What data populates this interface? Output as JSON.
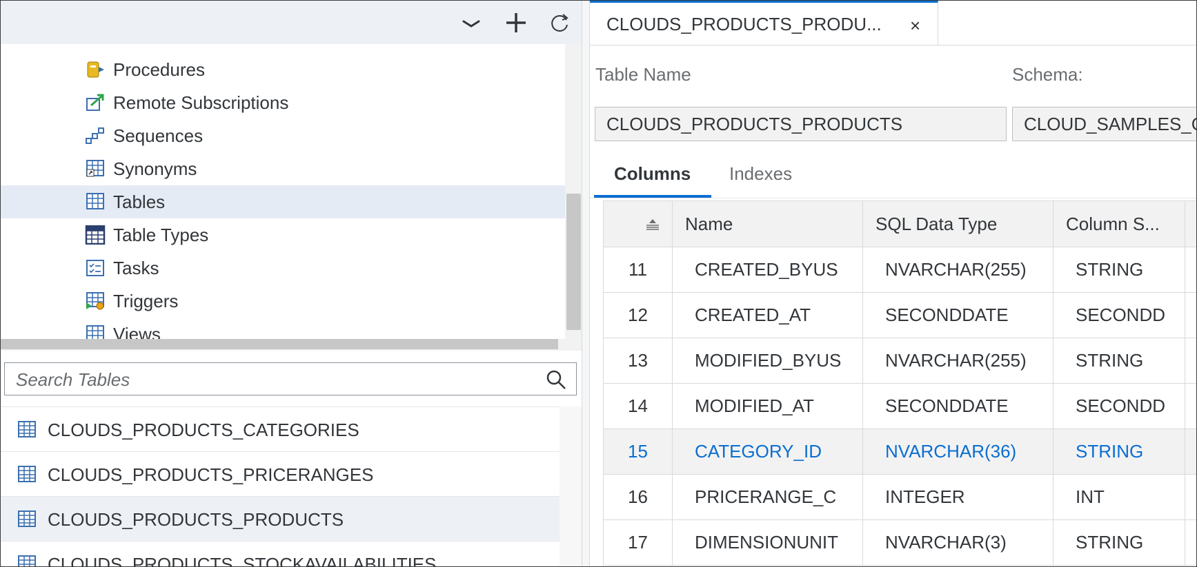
{
  "left_toolbar": {
    "icons": [
      "chevron-down-icon",
      "plus-icon",
      "refresh-icon"
    ]
  },
  "tree": {
    "items": [
      {
        "label": "Procedures",
        "icon": "procedures-icon"
      },
      {
        "label": "Remote Subscriptions",
        "icon": "remote-subscriptions-icon"
      },
      {
        "label": "Sequences",
        "icon": "sequences-icon"
      },
      {
        "label": "Synonyms",
        "icon": "synonyms-icon"
      },
      {
        "label": "Tables",
        "icon": "tables-icon",
        "selected": true
      },
      {
        "label": "Table Types",
        "icon": "table-types-icon"
      },
      {
        "label": "Tasks",
        "icon": "tasks-icon"
      },
      {
        "label": "Triggers",
        "icon": "triggers-icon"
      },
      {
        "label": "Views",
        "icon": "views-icon"
      }
    ]
  },
  "search": {
    "placeholder": "Search Tables",
    "value": ""
  },
  "table_list": {
    "items": [
      {
        "label": "CLOUDS_PRODUCTS_CATEGORIES"
      },
      {
        "label": "CLOUDS_PRODUCTS_PRICERANGES"
      },
      {
        "label": "CLOUDS_PRODUCTS_PRODUCTS",
        "selected": true
      },
      {
        "label": "CLOUDS_PRODUCTS_STOCKAVAILABILITIES"
      }
    ]
  },
  "editor": {
    "tab_title": "CLOUDS_PRODUCTS_PRODU...",
    "tab_close": "×",
    "table_name_label": "Table Name",
    "table_name_value": "CLOUDS_PRODUCTS_PRODUCTS",
    "schema_label": "Schema:",
    "schema_value": "CLOUD_SAMPLES_C",
    "tabs": [
      {
        "label": "Columns",
        "active": true
      },
      {
        "label": "Indexes",
        "active": false
      }
    ]
  },
  "columns_grid": {
    "headers": [
      "",
      "Name",
      "SQL Data Type",
      "Column S..."
    ],
    "rows": [
      {
        "num": "11",
        "name": "CREATED_BYUS",
        "sql_type": "NVARCHAR(255)",
        "column_store": "STRING"
      },
      {
        "num": "12",
        "name": "CREATED_AT",
        "sql_type": "SECONDDATE",
        "column_store": "SECONDD"
      },
      {
        "num": "13",
        "name": "MODIFIED_BYUS",
        "sql_type": "NVARCHAR(255)",
        "column_store": "STRING"
      },
      {
        "num": "14",
        "name": "MODIFIED_AT",
        "sql_type": "SECONDDATE",
        "column_store": "SECONDD"
      },
      {
        "num": "15",
        "name": "CATEGORY_ID",
        "sql_type": "NVARCHAR(36)",
        "column_store": "STRING",
        "selected": true
      },
      {
        "num": "16",
        "name": "PRICERANGE_C",
        "sql_type": "INTEGER",
        "column_store": "INT"
      },
      {
        "num": "17",
        "name": "DIMENSIONUNIT",
        "sql_type": "NVARCHAR(3)",
        "column_store": "STRING"
      }
    ]
  },
  "colors": {
    "accent": "#0a6ed1",
    "toolbar_bg": "#edf0f5",
    "selected_bg": "#e5ebf4"
  }
}
